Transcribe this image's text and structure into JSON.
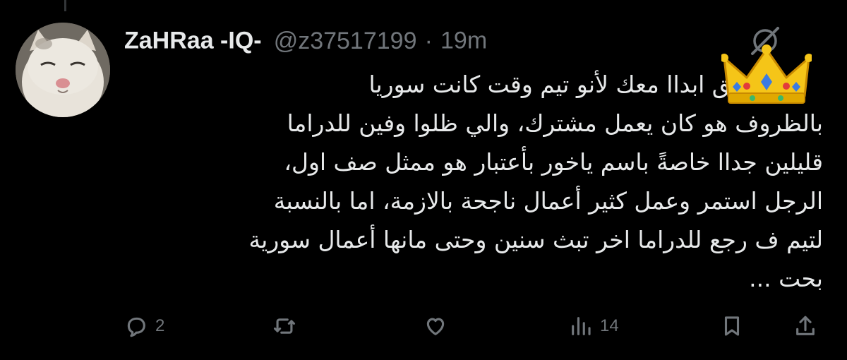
{
  "tweet": {
    "display_name": "ZaHRaa -IQ-",
    "handle": "@z37517199",
    "separator": "·",
    "timestamp": "19m",
    "body_lines": [
      "و ما اتفق ابداا معك لأنو تيم وقت كانت سوريا",
      "بالظروف هو كان يعمل مشترك، والي ظلوا وفين للدراما",
      "قليلين جداا خاصةً باسم ياخور بأعتبار هو ممثل صف اول،",
      "الرجل استمر وعمل كثير أعمال ناجحة بالازمة، اما بالنسبة",
      "لتيم ف رجع للدراما اخر تبث سنين وحتى مانها أعمال سورية",
      "بحت ..."
    ]
  },
  "actions": {
    "reply_count": "2",
    "retweet_count": "",
    "like_count": "",
    "views_count": "14"
  },
  "icons": {
    "header_action": "grok-icon",
    "overlay": "crown-emoji",
    "reply": "reply-icon",
    "retweet": "retweet-icon",
    "like": "heart-icon",
    "views": "views-chart-icon",
    "bookmark": "bookmark-icon",
    "share": "share-icon"
  },
  "colors": {
    "background": "#000000",
    "primary_text": "#e7e9ea",
    "secondary_text": "#71767b",
    "crown_gold": "#f5c518"
  }
}
